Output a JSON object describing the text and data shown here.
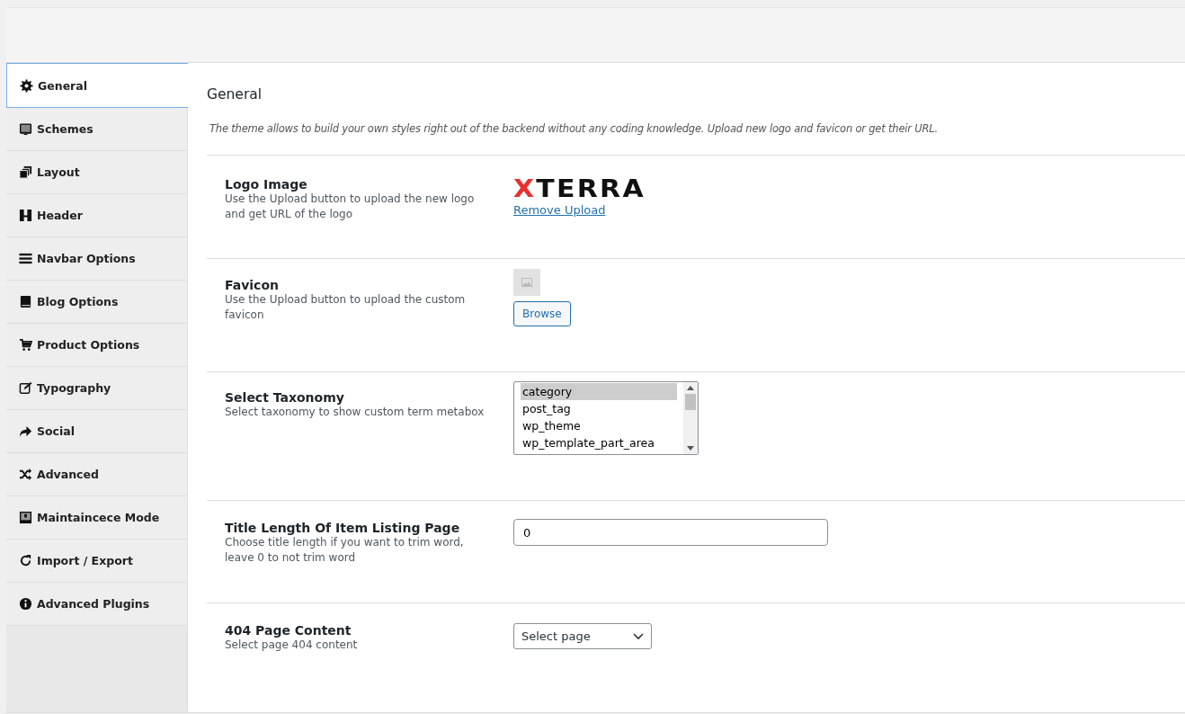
{
  "sidebar": {
    "items": [
      {
        "label": "General",
        "selected": true
      },
      {
        "label": "Schemes",
        "selected": false
      },
      {
        "label": "Layout",
        "selected": false
      },
      {
        "label": "Header",
        "selected": false
      },
      {
        "label": "Navbar Options",
        "selected": false
      },
      {
        "label": "Blog Options",
        "selected": false
      },
      {
        "label": "Product Options",
        "selected": false
      },
      {
        "label": "Typography",
        "selected": false
      },
      {
        "label": "Social",
        "selected": false
      },
      {
        "label": "Advanced",
        "selected": false
      },
      {
        "label": "Maintaincece Mode",
        "selected": false
      },
      {
        "label": "Import / Export",
        "selected": false
      },
      {
        "label": "Advanced Plugins",
        "selected": false
      }
    ]
  },
  "section": {
    "title": "General",
    "intro": "The theme allows to build your own styles right out of the backend without any coding knowledge. Upload new logo and favicon or get their URL."
  },
  "fields": [
    {
      "kind": "logo",
      "label": "Logo Image",
      "description": "Use the Upload button to upload the new logo and get URL of the logo",
      "logo_text": "XTERRA",
      "link": "Remove Upload"
    },
    {
      "kind": "favicon",
      "label": "Favicon",
      "description": "Use the Upload button to upload the custom favicon",
      "button": "Browse"
    },
    {
      "kind": "listbox",
      "label": "Select Taxonomy",
      "description": "Select taxonomy to show custom term metabox",
      "options": [
        {
          "label": "category",
          "selected": true
        },
        {
          "label": "post_tag",
          "selected": false
        },
        {
          "label": "wp_theme",
          "selected": false
        },
        {
          "label": "wp_template_part_area",
          "selected": false
        }
      ]
    },
    {
      "kind": "text",
      "label": "Title Length Of Item Listing Page",
      "description": "Choose title length if you want to trim word, leave 0 to not trim word",
      "value": "0"
    },
    {
      "kind": "select",
      "label": "404 Page Content",
      "description": "Select page 404 content",
      "value": "Select page"
    }
  ]
}
